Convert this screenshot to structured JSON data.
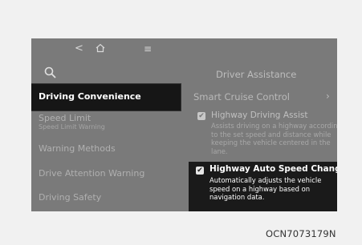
{
  "topbar": {
    "back_icon": "chevron-left-icon",
    "home_icon": "home-icon",
    "menu_icon": "menu-icon"
  },
  "header": {
    "search_icon": "search-icon",
    "title": "Driver Assistance"
  },
  "left_menu": {
    "items": [
      {
        "label": "Driving Convenience"
      },
      {
        "label": "Speed Limit",
        "sublabel": "Speed Limit Warning"
      },
      {
        "label": "Warning Methods"
      },
      {
        "label": "Drive Attention Warning"
      },
      {
        "label": "Driving Safety"
      }
    ]
  },
  "right_pane": {
    "smart_cruise": {
      "label": "Smart Cruise Control",
      "chevron": "›"
    },
    "highway_driving_assist": {
      "checked": true,
      "title": "Highway Driving Assist",
      "description": "Assists driving on a highway according to the set speed and distance while keeping the vehicle centered in the lane."
    },
    "highway_auto_speed": {
      "checked": true,
      "title": "Highway Auto Speed Change",
      "description": "Automatically adjusts the vehicle speed on a highway based on navigation data."
    }
  },
  "figure_code": "OCN7073179N"
}
